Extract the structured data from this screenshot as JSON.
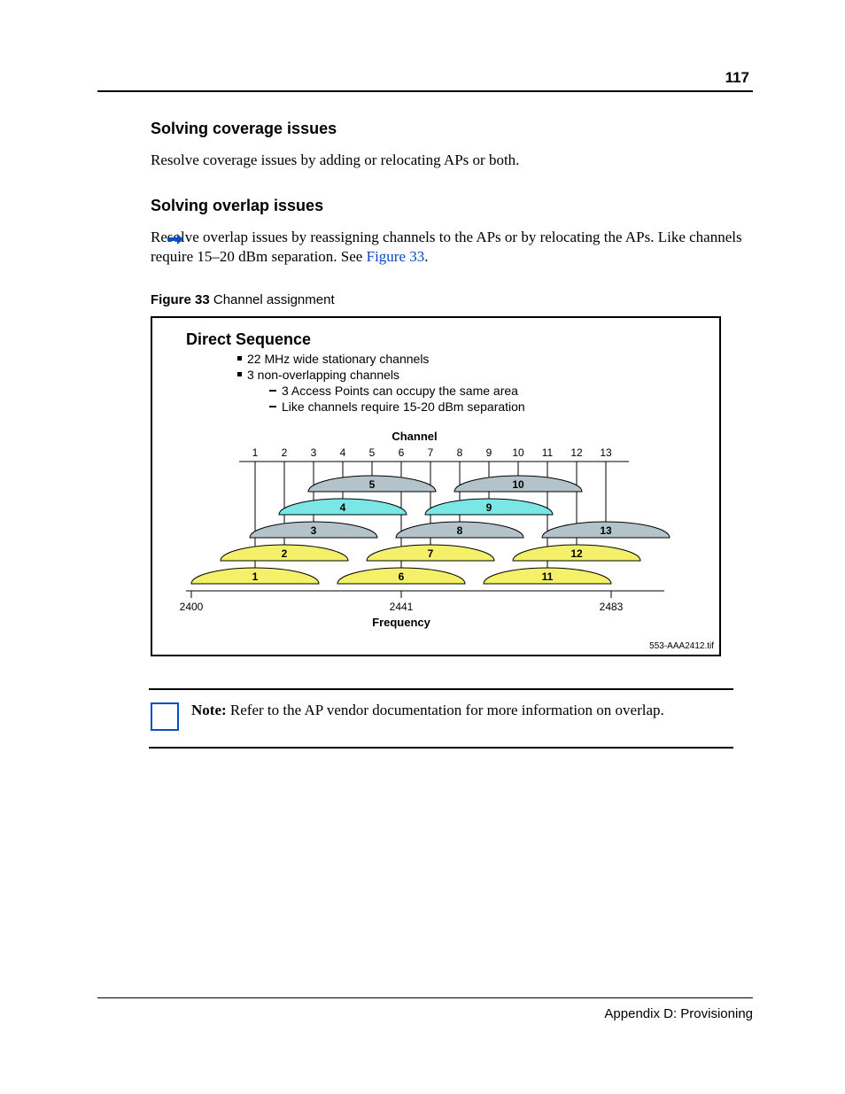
{
  "page_number": "117",
  "footer": "Appendix D: Provisioning",
  "section1": {
    "heading": "Solving coverage issues",
    "body": "Resolve coverage issues by adding or relocating APs or both."
  },
  "section2": {
    "heading": "Solving overlap issues",
    "body_pre": "Resolve overlap issues by reassigning channels to the APs or by relocating the APs. Like channels require 15–20 dBm separation. See ",
    "body_link": "Figure 33",
    "body_post": "."
  },
  "figure": {
    "caption_label": "Figure 33",
    "caption_text": "   Channel assignment",
    "title": "Direct Sequence",
    "bullet1": "22 MHz wide stationary channels",
    "bullet2": "3 non-overlapping channels",
    "sub1": "3 Access Points can occupy the same area",
    "sub2": "Like channels require 15-20 dBm separation",
    "axis_top": "Channel",
    "axis_bottom": "Frequency",
    "freq_left": "2400",
    "freq_mid": "2441",
    "freq_right": "2483",
    "cite": "553-AAA2412.tif"
  },
  "note": {
    "label": "Note:",
    "text": " Refer to the AP vendor documentation for more information on overlap."
  },
  "chart_data": {
    "type": "diagram",
    "title": "Direct Sequence channel assignment (2.4 GHz)",
    "xlabel": "Frequency (MHz)",
    "ylabel": "Channel",
    "channel_ticks": [
      1,
      2,
      3,
      4,
      5,
      6,
      7,
      8,
      9,
      10,
      11,
      12,
      13
    ],
    "frequency_range_mhz": [
      2400,
      2483
    ],
    "frequency_ticks_mhz": [
      2400,
      2441,
      2483
    ],
    "channel_width_mhz": 22,
    "rows": [
      {
        "row": 1,
        "color": "#b3c3c9",
        "channels": [
          5,
          10
        ]
      },
      {
        "row": 2,
        "color": "#7ae7e6",
        "channels": [
          4,
          9
        ]
      },
      {
        "row": 3,
        "color": "#b3c3c9",
        "channels": [
          3,
          8,
          13
        ]
      },
      {
        "row": 4,
        "color": "#f5f06a",
        "channels": [
          2,
          7,
          12
        ]
      },
      {
        "row": 5,
        "color": "#f5f06a",
        "channels": [
          1,
          6,
          11
        ]
      }
    ],
    "non_overlapping_example": [
      1,
      6,
      11
    ],
    "notes": [
      "22 MHz wide stationary channels",
      "3 non-overlapping channels",
      "3 Access Points can occupy the same area",
      "Like channels require 15-20 dBm separation"
    ]
  }
}
